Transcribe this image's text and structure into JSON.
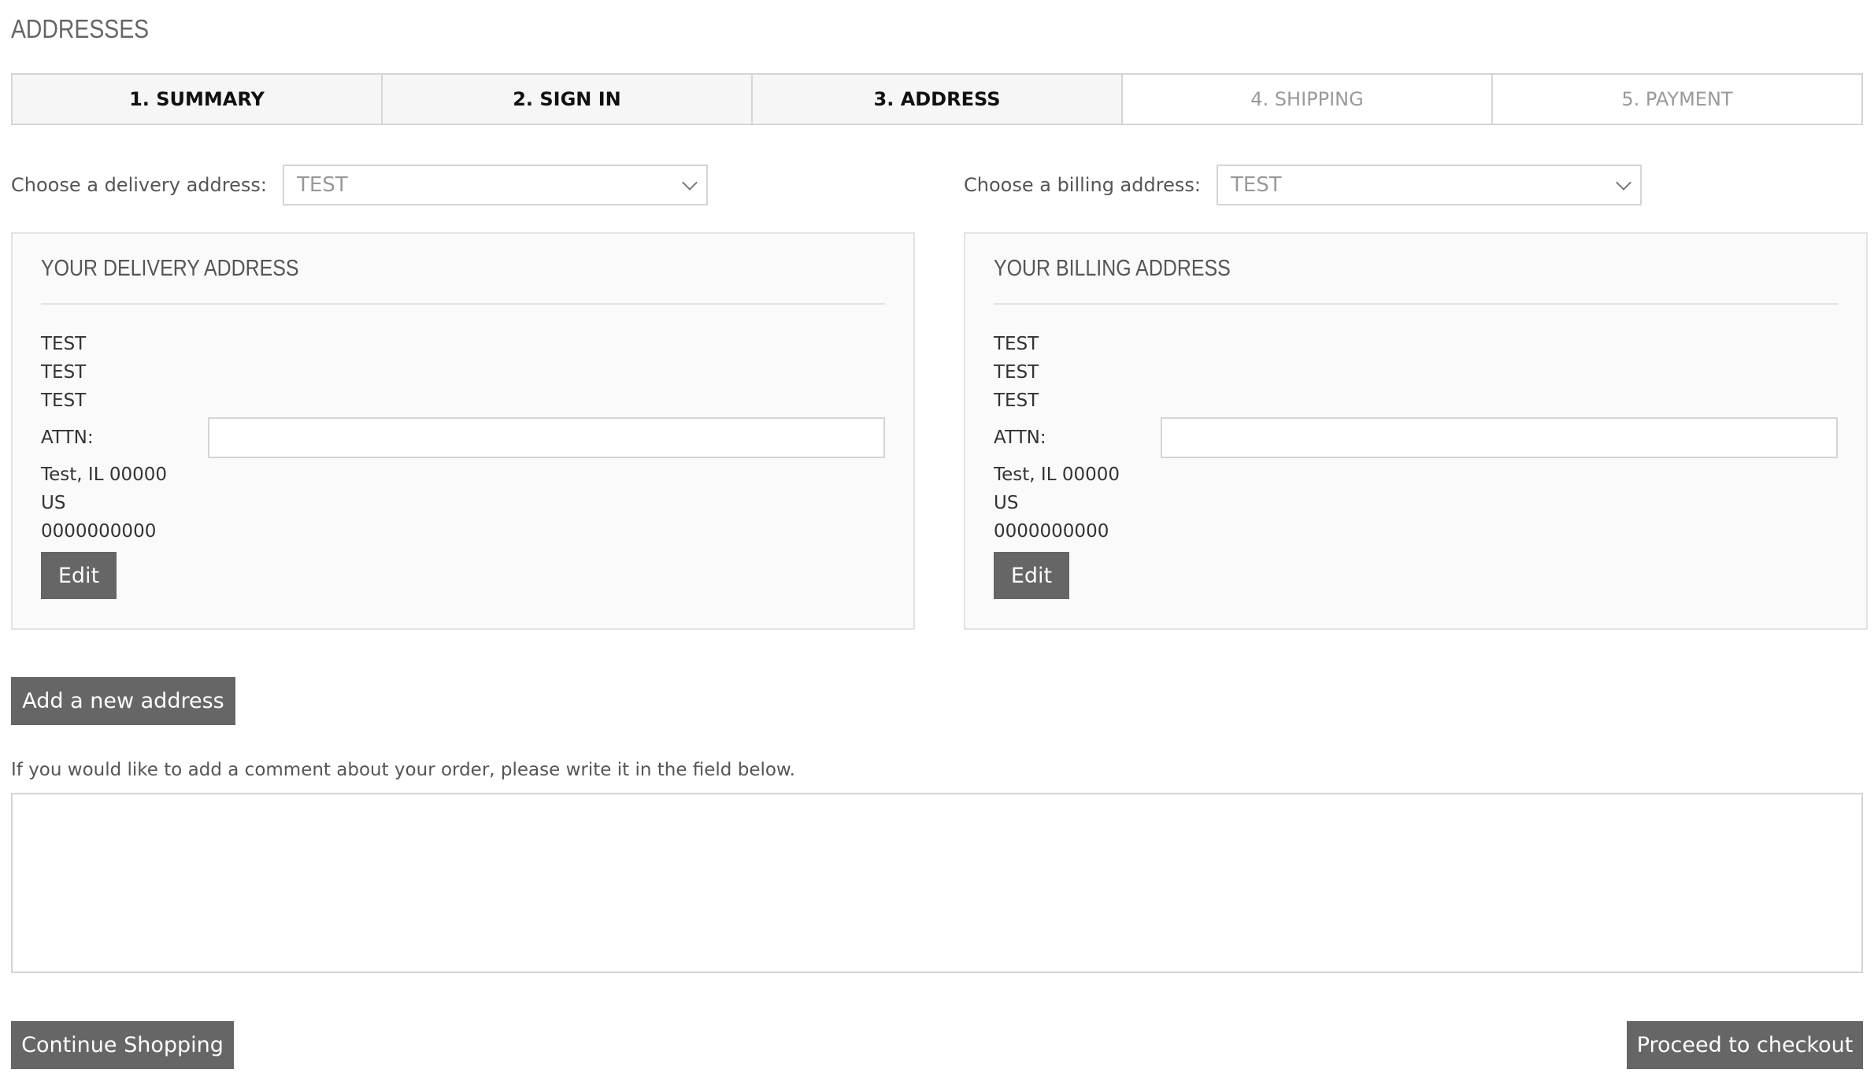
{
  "page": {
    "title": "ADDRESSES"
  },
  "steps": [
    {
      "label": "1. SUMMARY",
      "state": "done"
    },
    {
      "label": "2. SIGN IN",
      "state": "done"
    },
    {
      "label": "3. ADDRESS",
      "state": "current"
    },
    {
      "label": "4. SHIPPING",
      "state": "todo"
    },
    {
      "label": "5. PAYMENT",
      "state": "todo"
    }
  ],
  "delivery": {
    "choose_label": "Choose a delivery address:",
    "selected": "TEST",
    "box_title": "YOUR DELIVERY ADDRESS",
    "lines_top": [
      "TEST",
      "TEST",
      "TEST"
    ],
    "attn_label": "ATTN:",
    "attn_value": "",
    "lines_bottom": [
      "Test, IL 00000",
      "US",
      "0000000000"
    ],
    "edit_label": "Edit"
  },
  "billing": {
    "choose_label": "Choose a billing address:",
    "selected": "TEST",
    "box_title": "YOUR BILLING ADDRESS",
    "lines_top": [
      "TEST",
      "TEST",
      "TEST"
    ],
    "attn_label": "ATTN:",
    "attn_value": "",
    "lines_bottom": [
      "Test, IL 00000",
      "US",
      "0000000000"
    ],
    "edit_label": "Edit"
  },
  "actions": {
    "add_address": "Add a new address",
    "comment_label": "If you would like to add a comment about your order, please write it in the field below.",
    "comment_value": "",
    "continue_shopping": "Continue Shopping",
    "proceed": "Proceed to checkout"
  },
  "colors": {
    "button_bg": "#666666",
    "step_done_bg": "#f6f6f6",
    "border": "#d6d4d4",
    "box_bg": "#fafafa"
  }
}
